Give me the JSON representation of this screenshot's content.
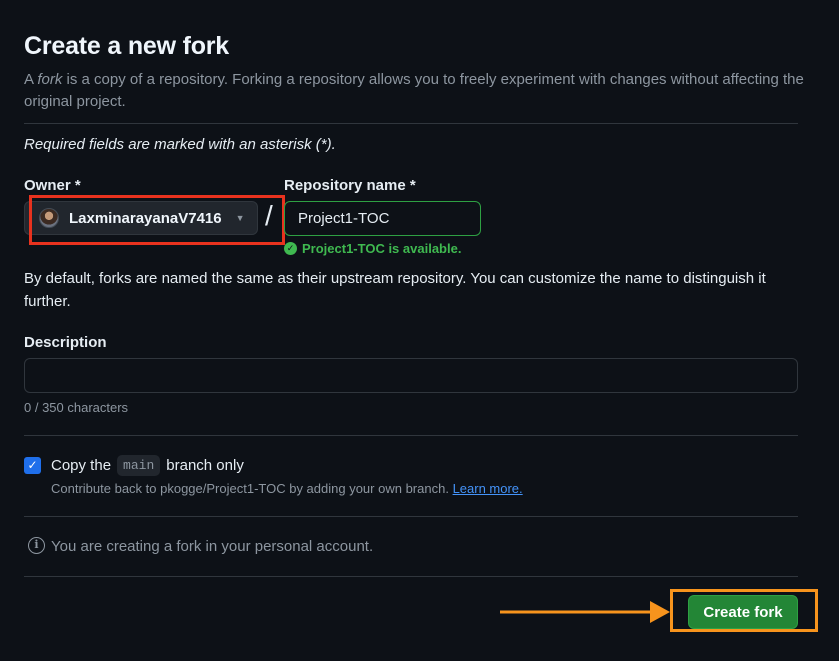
{
  "header": {
    "title": "Create a new fork",
    "intro_prefix": "A ",
    "intro_em": "fork",
    "intro_suffix": " is a copy of a repository. Forking a repository allows you to freely experiment with changes without affecting the original project."
  },
  "form": {
    "required_note": "Required fields are marked with an asterisk (*).",
    "owner_label": "Owner *",
    "owner_value": "LaxminarayanaV7416",
    "separator": "/",
    "repo_label": "Repository name *",
    "repo_value": "Project1-TOC",
    "availability": "Project1-TOC is available.",
    "default_note": "By default, forks are named the same as their upstream repository. You can customize the name to distinguish it further.",
    "description_label": "Description",
    "description_value": "",
    "char_count": "0 / 350 characters",
    "copy_branch": {
      "checked": true,
      "label_before": "Copy the",
      "branch": "main",
      "label_after": "branch only",
      "help_text": "Contribute back to pkogge/Project1-TOC by adding your own branch.",
      "learn_more": "Learn more."
    },
    "account_note": "You are creating a fork in your personal account.",
    "submit_label": "Create fork"
  },
  "annotations": {
    "owner_highlight_color": "#e8321e",
    "submit_highlight_color": "#f7941d"
  },
  "icons": [
    "avatar",
    "chevron-down-icon",
    "check-circle-icon",
    "checkbox-check-icon",
    "info-icon",
    "arrow-icon"
  ]
}
